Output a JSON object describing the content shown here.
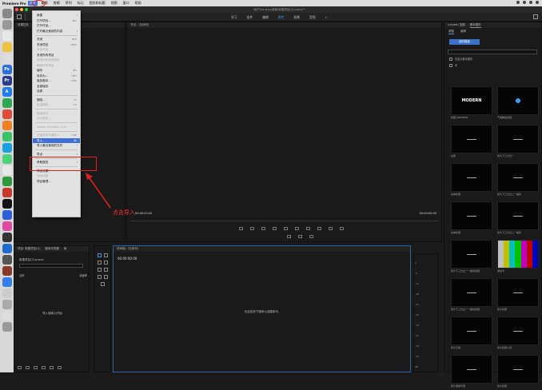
{
  "menubar": {
    "app": "Premiere Pro",
    "items": [
      "文件",
      "编辑",
      "剪辑",
      "序列",
      "标记",
      "图形和标题",
      "视图",
      "窗口",
      "帮助"
    ]
  },
  "window": {
    "title": "/用户/ae.plus/桌面/新建项目(2).prproj *"
  },
  "workspaces": [
    "学习",
    "组件",
    "编辑",
    "颜色",
    "效果",
    "音频"
  ],
  "workspace_selected": "颜色",
  "source_panel": {
    "tabs": [
      "效果控件",
      "源:（无剪辑）"
    ]
  },
  "program_panel": {
    "title": "节目:（无序列）",
    "timecode_left": "00:00:00:00",
    "timecode_right": "00:00:00:00"
  },
  "right_panel": {
    "tabs": [
      "Lumetri 范围",
      "基本图形"
    ],
    "subtabs": [
      "浏览",
      "编辑"
    ],
    "browse_button": "我的模板",
    "search_placeholder": "",
    "check1": "仅显示基本图形",
    "check2": "本",
    "templates": [
      {
        "thumb": "MODERN",
        "cap": "标题_MODERN"
      },
      {
        "thumb": "",
        "cap": "气泡弹出标题"
      },
      {
        "thumb": "",
        "cap": "白色"
      },
      {
        "thumb": "",
        "cap": "影片下三分之一"
      },
      {
        "thumb": "",
        "cap": "基本标题"
      },
      {
        "thumb": "",
        "cap": "影片下三分之二一般化"
      },
      {
        "thumb": "",
        "cap": "基本标题"
      },
      {
        "thumb": "",
        "cap": "影片下三分之二一般化"
      },
      {
        "thumb": "",
        "cap": "影片下三分之一一般化标题"
      },
      {
        "thumb": "",
        "cap": "测试卡"
      },
      {
        "thumb": "",
        "cap": "影片下三分之一一般化标题"
      },
      {
        "thumb": "",
        "cap": "影片标题"
      },
      {
        "thumb": "",
        "cap": "影片元素"
      },
      {
        "thumb": "",
        "cap": "影片标题人员"
      },
      {
        "thumb": "",
        "cap": "影片滚动字幕"
      },
      {
        "thumb": "",
        "cap": "影片标题"
      }
    ]
  },
  "project_panel": {
    "tabs": [
      "项目: 新建项目(2)",
      "媒体浏览器",
      "库"
    ],
    "filename": "新建项目(2).prproj",
    "col_name": "名称",
    "col_rate": "帧速率",
    "empty_text": "导入媒体以开始"
  },
  "timeline_panel": {
    "tabs": [
      "时间轴:（无序列）"
    ],
    "timecode": "00:00:00:00",
    "empty_text": "在此处放下媒体以创建序列。"
  },
  "audio_levels": [
    "0",
    "-6",
    "-12",
    "-18",
    "-24",
    "-30",
    "-36",
    "-42",
    "-48",
    "-54",
    "dB"
  ],
  "file_menu": [
    {
      "label": "新建",
      "arrow": true
    },
    {
      "label": "打开项目...",
      "shortcut": "⌘O"
    },
    {
      "label": "打开作品...",
      "shortcut": ""
    },
    {
      "label": "打开最近使用的内容",
      "arrow": true
    },
    {
      "sep": true
    },
    {
      "label": "关闭",
      "shortcut": "⌘W"
    },
    {
      "label": "关闭项目",
      "shortcut": "⇧⌘W"
    },
    {
      "label": "关闭作品",
      "disabled": true
    },
    {
      "label": "关闭所有项目",
      "shortcut": ""
    },
    {
      "label": "关闭所有其他项目",
      "disabled": true
    },
    {
      "label": "刷新所有项目",
      "disabled": true
    },
    {
      "label": "保存",
      "shortcut": "⌘S"
    },
    {
      "label": "另存为...",
      "shortcut": "⇧⌘S"
    },
    {
      "label": "保存副本...",
      "shortcut": "⌥⌘S"
    },
    {
      "label": "全部保存",
      "shortcut": ""
    },
    {
      "label": "还原",
      "shortcut": ""
    },
    {
      "sep": true
    },
    {
      "label": "捕捉...",
      "shortcut": "F5"
    },
    {
      "label": "批量捕捉...",
      "shortcut": "F6",
      "disabled": true
    },
    {
      "sep": true
    },
    {
      "label": "链接媒体...",
      "disabled": true
    },
    {
      "label": "设为脱机...",
      "disabled": true
    },
    {
      "sep": true
    },
    {
      "label": "Adobe Dynamic Link",
      "arrow": true,
      "disabled": true
    },
    {
      "sep": true
    },
    {
      "label": "从媒体浏览器导入",
      "shortcut": "⌥⌘I",
      "disabled": true
    },
    {
      "label": "导入...",
      "shortcut": "⌘I",
      "highlighted": true
    },
    {
      "label": "导入最近使用的文件",
      "arrow": true
    },
    {
      "sep": true
    },
    {
      "label": "导出",
      "arrow": true
    },
    {
      "sep": true
    },
    {
      "label": "获取属性",
      "arrow": true
    },
    {
      "sep": true
    },
    {
      "label": "项目设置",
      "arrow": true
    },
    {
      "label": "作品设置",
      "arrow": true,
      "disabled": true
    },
    {
      "label": "项目管理...",
      "shortcut": ""
    }
  ],
  "annotation": {
    "text": "点击导入"
  }
}
